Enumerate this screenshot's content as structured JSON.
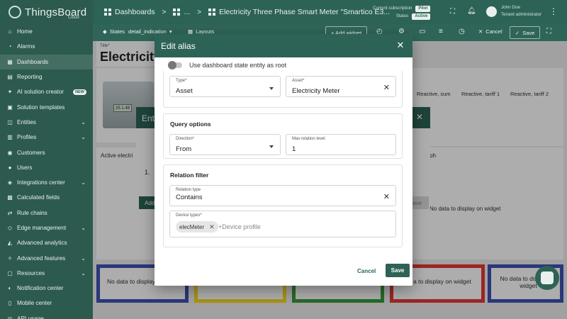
{
  "brand": {
    "name": "ThingsBoard",
    "sub": "Cloud"
  },
  "sidebar": {
    "items": [
      {
        "label": "Home",
        "icon": "home-icon"
      },
      {
        "label": "Alarms",
        "icon": "alarm-icon"
      },
      {
        "label": "Dashboards",
        "icon": "dashboard-icon",
        "active": true
      },
      {
        "label": "Reporting",
        "icon": "report-icon"
      },
      {
        "label": "AI solution creator",
        "icon": "ai-icon",
        "badge": "NEW"
      },
      {
        "label": "Solution templates",
        "icon": "template-icon"
      },
      {
        "label": "Entities",
        "icon": "entities-icon",
        "expand": true
      },
      {
        "label": "Profiles",
        "icon": "profiles-icon",
        "expand": true
      },
      {
        "label": "Customers",
        "icon": "customers-icon"
      },
      {
        "label": "Users",
        "icon": "users-icon"
      },
      {
        "label": "Integrations center",
        "icon": "integrations-icon",
        "expand": true
      },
      {
        "label": "Calculated fields",
        "icon": "calc-icon"
      },
      {
        "label": "Rule chains",
        "icon": "rule-chain-icon"
      },
      {
        "label": "Edge management",
        "icon": "edge-icon",
        "expand": true
      },
      {
        "label": "Advanced analytics",
        "icon": "analytics-icon"
      },
      {
        "label": "Advanced features",
        "icon": "features-icon",
        "expand": true
      },
      {
        "label": "Resources",
        "icon": "resources-icon",
        "expand": true
      },
      {
        "label": "Notification center",
        "icon": "notification-icon"
      },
      {
        "label": "Mobile center",
        "icon": "mobile-icon"
      },
      {
        "label": "API usage",
        "icon": "api-icon"
      }
    ]
  },
  "topbar": {
    "crumb1": "Dashboards",
    "crumb2": "...",
    "crumb3": "Electricity Three Phase Smart Meter \"Smartico E3...",
    "subscription_label": "Current subscription",
    "subscription_value": "Pilot",
    "status_label": "Status",
    "status_value": "Active",
    "user_name": "John Doe",
    "user_role": "Tenant administrator"
  },
  "editbar": {
    "states_label": "States",
    "state_value": "detail_indication",
    "layouts": "Layouts",
    "add_widget": "+ Add widget",
    "cancel": "Cancel",
    "save": "Save"
  },
  "background": {
    "title_label": "Title*",
    "title_value": "Electricity",
    "meter_screen": "25.1.48",
    "col1": "Reactive, sum",
    "col2": "Reactive, tariff 1",
    "col3": "Reactive, tariff 2",
    "active_label": "Active electri",
    "graph_label": "ph",
    "list_num": "1.",
    "add_btn": "Add",
    "save_ghost": "ave",
    "no_data": "No data to display on widget",
    "card1": "No data to display o",
    "card5": "a to display on widget",
    "card6a": "No data to display on",
    "card6b": "widget",
    "entity_dialog_title": "Enti"
  },
  "modal": {
    "title": "Edit alias",
    "toggle_label": "Use dashboard state entity as root",
    "type_label": "Type*",
    "type_value": "Asset",
    "asset_label": "Asset*",
    "asset_value": "Electricity Meter",
    "query_title": "Query options",
    "direction_label": "Direction*",
    "direction_value": "From",
    "max_level_label": "Max relation level",
    "max_level_value": "1",
    "relation_title": "Relation filter",
    "relation_type_label": "Relation type",
    "relation_type_value": "Contains",
    "device_types_label": "Device types*",
    "chip": "elecMeter",
    "device_placeholder": "+Device profile",
    "cancel": "Cancel",
    "save": "Save"
  },
  "colors": {
    "primary": "#2d6356",
    "card_blue": "#3f51b5",
    "card_yellow": "#f9d71c",
    "card_green": "#3a9b3a",
    "card_red": "#e53935"
  }
}
